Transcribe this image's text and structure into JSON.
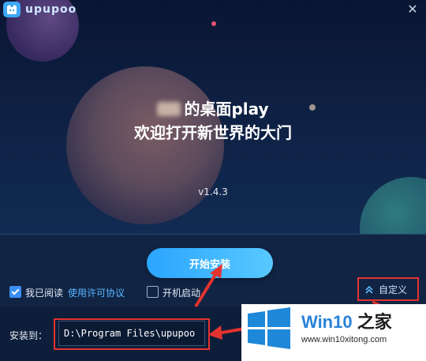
{
  "window": {
    "brand": "upupoo",
    "close_label": "✕"
  },
  "hero": {
    "line1": "的桌面play",
    "line2": "欢迎打开新世界的大门",
    "version": "v1.4.3"
  },
  "actions": {
    "install_label": "开始安装",
    "agree_label": "我已阅读",
    "agree_checked": true,
    "license_link": "使用许可协议",
    "autostart_label": "开机启动",
    "autostart_checked": false,
    "custom_label": "自定义"
  },
  "install_path": {
    "label": "安装到：",
    "value": "D:\\Program Files\\upupoo"
  },
  "watermark": {
    "title_prefix": "Win10",
    "title_suffix": " 之家",
    "url": "www.win10xitong.com"
  },
  "colors": {
    "accent": "#2aa5ff",
    "annotation": "#e3332f",
    "link": "#59b7ff"
  }
}
